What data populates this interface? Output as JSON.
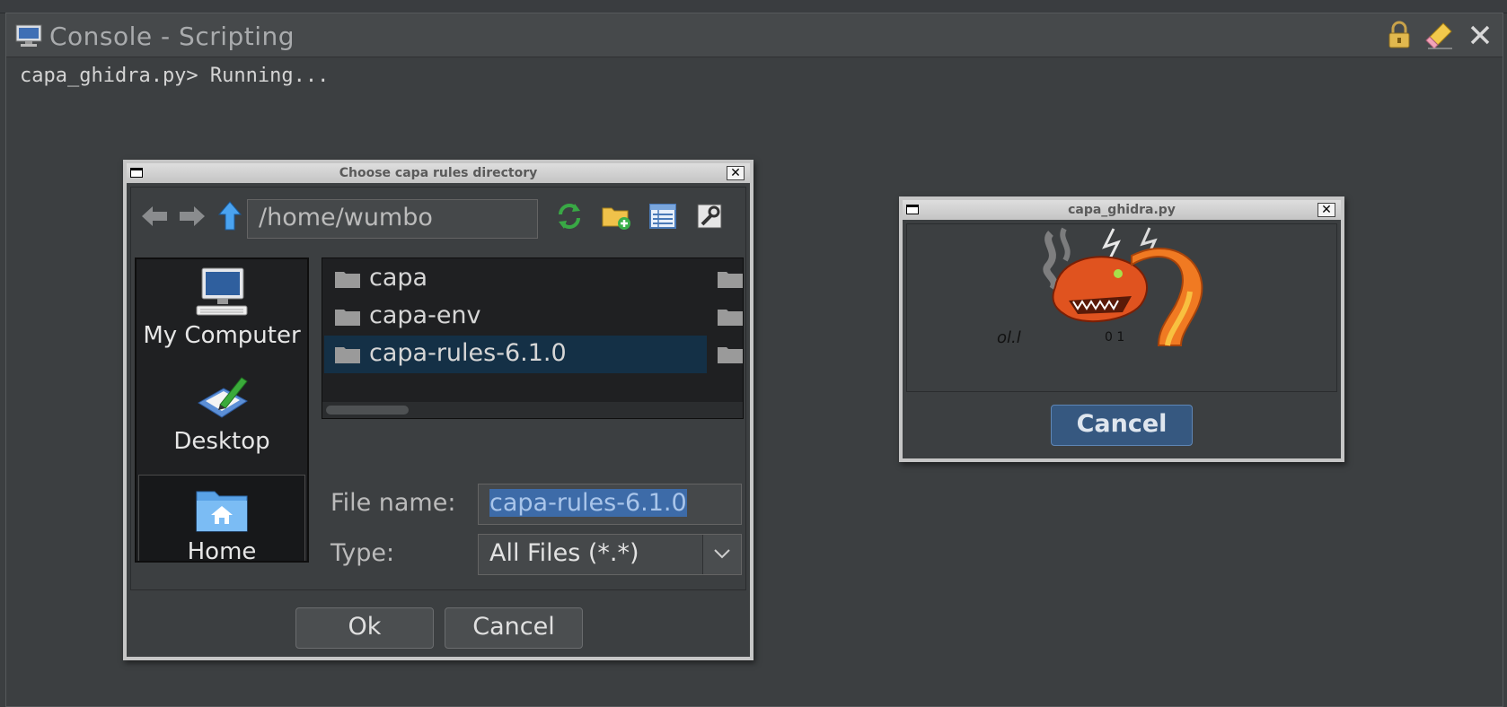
{
  "console": {
    "title": "Console - Scripting",
    "output_line": "capa_ghidra.py> Running...",
    "icons": [
      "monitor-icon",
      "lock-icon",
      "clear-icon",
      "close-icon"
    ]
  },
  "file_dialog": {
    "title": "Choose capa rules directory",
    "close_glyph": "✕",
    "path": "/home/wumbo",
    "nav_icons": [
      "back-arrow-icon",
      "forward-arrow-icon",
      "up-arrow-icon",
      "refresh-icon",
      "new-folder-icon",
      "details-view-icon",
      "properties-icon"
    ],
    "places": [
      {
        "label": "My Computer",
        "icon": "computer-icon"
      },
      {
        "label": "Desktop",
        "icon": "desktop-icon"
      },
      {
        "label": "Home",
        "icon": "home-folder-icon"
      }
    ],
    "files": [
      {
        "name": "capa",
        "selected": false
      },
      {
        "name": "capa-env",
        "selected": false
      },
      {
        "name": "capa-rules-6.1.0",
        "selected": true
      }
    ],
    "file_name_label": "File name:",
    "file_name_value": "capa-rules-6.1.0",
    "type_label": "Type:",
    "type_value": "All Files (*.*)",
    "ok_label": "Ok",
    "cancel_label": "Cancel"
  },
  "progress_dialog": {
    "title": "capa_ghidra.py",
    "close_glyph": "✕",
    "cancel_label": "Cancel",
    "image_icon": "ghidra-dragon-icon"
  },
  "colors": {
    "background": "#3c3f41",
    "selection": "#143046",
    "primary_button": "#365880",
    "text_selection": "#3d6ba8"
  }
}
